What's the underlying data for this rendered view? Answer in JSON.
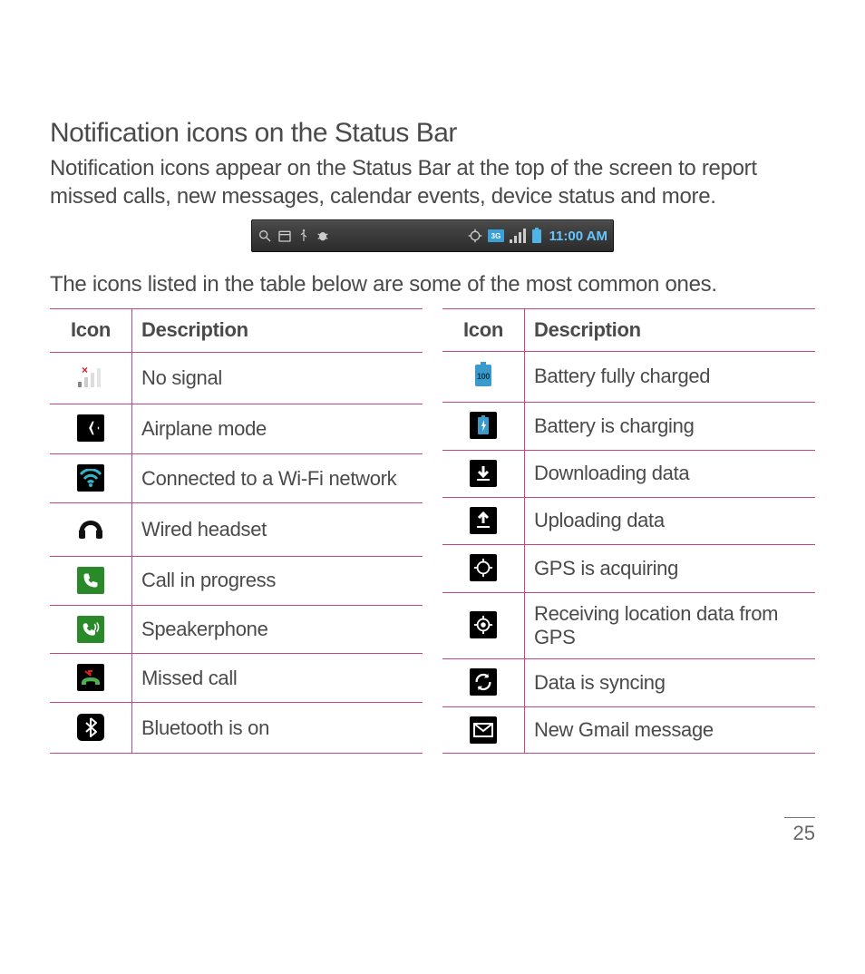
{
  "section": {
    "title": "Notification icons on the Status Bar",
    "intro": "Notification icons appear on the Status Bar at the top of the screen to report missed calls, new messages, calendar events, device status and more.",
    "table_intro": "The icons listed in the table below are some of the most common ones."
  },
  "statusbar": {
    "time": "11:00 AM"
  },
  "headers": {
    "icon": "Icon",
    "description": "Description"
  },
  "left_table": [
    {
      "icon": "no-signal",
      "description": "No signal"
    },
    {
      "icon": "airplane",
      "description": "Airplane mode"
    },
    {
      "icon": "wifi",
      "description": "Connected to a Wi-Fi network"
    },
    {
      "icon": "headset",
      "description": "Wired headset"
    },
    {
      "icon": "call",
      "description": "Call in progress"
    },
    {
      "icon": "speakerphone",
      "description": "Speakerphone"
    },
    {
      "icon": "missed-call",
      "description": "Missed call"
    },
    {
      "icon": "bluetooth",
      "description": "Bluetooth is on"
    }
  ],
  "right_table": [
    {
      "icon": "battery-full",
      "description": "Battery fully charged"
    },
    {
      "icon": "battery-charging",
      "description": "Battery is charging"
    },
    {
      "icon": "download",
      "description": "Downloading data"
    },
    {
      "icon": "upload",
      "description": "Uploading data"
    },
    {
      "icon": "gps-acquiring",
      "description": "GPS is acquiring"
    },
    {
      "icon": "gps-lock",
      "description": "Receiving location data from GPS"
    },
    {
      "icon": "sync",
      "description": "Data is syncing"
    },
    {
      "icon": "gmail",
      "description": "New Gmail message"
    }
  ],
  "page_number": "25"
}
